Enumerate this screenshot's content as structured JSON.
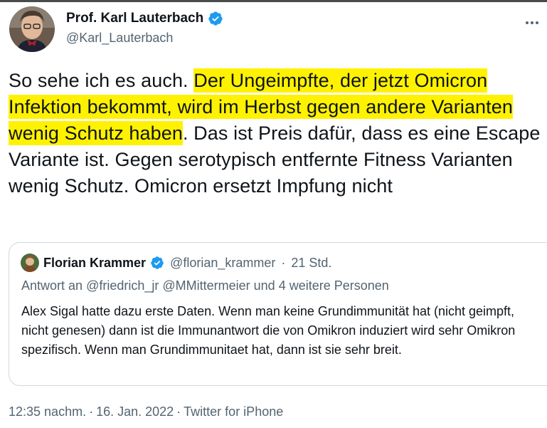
{
  "author": {
    "name": "Prof. Karl Lauterbach",
    "handle": "@Karl_Lauterbach"
  },
  "tweet": {
    "text_before": "So sehe ich es auch. ",
    "text_highlighted": "Der Ungeimpfte, der jetzt Omicron Infektion bekommt, wird im Herbst gegen andere Varianten wenig Schutz haben",
    "text_after": ". Das ist Preis dafür, dass es eine Escape Variante ist. Gegen serotypisch entfernte Fitness Varianten wenig Schutz. Omicron ersetzt Impfung nicht",
    "highlight_color": "#fff200"
  },
  "quoted": {
    "name": "Florian Krammer",
    "handle": "@florian_krammer",
    "time": "21 Std.",
    "reply_prefix": "Antwort an",
    "reply_users": "@friedrich_jr @MMittermeier",
    "reply_suffix": "und 4 weitere Personen",
    "text": "Alex Sigal hatte dazu erste Daten. Wenn man keine Grundimmunität hat (nicht geimpft, nicht genesen) dann ist die Immunantwort die von Omikron induziert wird sehr Omikron spezifisch. Wenn man Grundimmunitaet hat, dann ist sie sehr breit."
  },
  "meta": {
    "time": "12:35 nachm.",
    "date": "16. Jan. 2022",
    "source": "Twitter for iPhone"
  },
  "icons": {
    "verified": "verified-badge-icon",
    "more": "more-options-icon"
  },
  "colors": {
    "verified_blue": "#1d9bf0",
    "secondary_text": "#536471",
    "border": "#cfd9de"
  }
}
